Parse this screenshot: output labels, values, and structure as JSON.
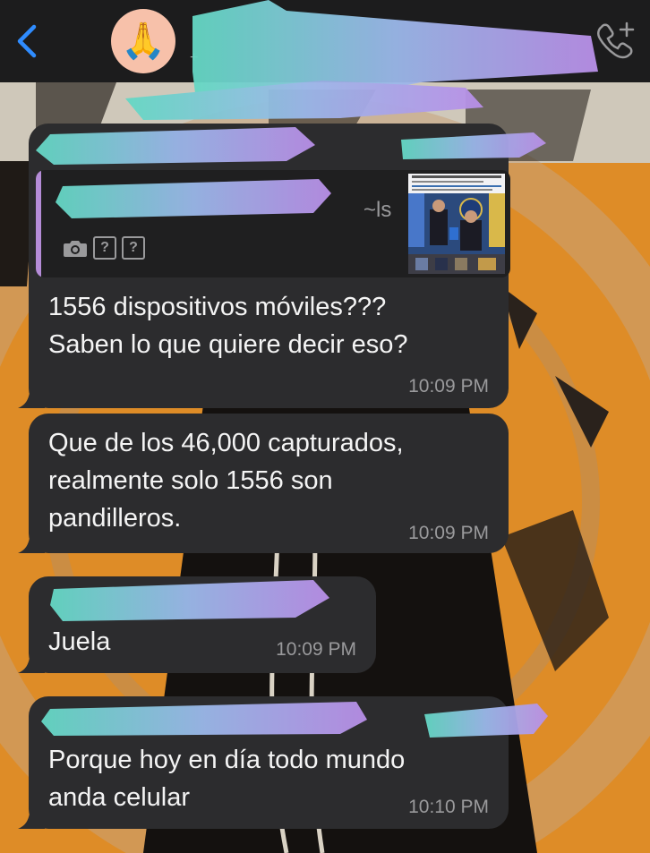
{
  "header": {
    "contact_name": "",
    "contact_sub": "+",
    "avatar_emoji": "🙏",
    "back_icon": "chevron-left-icon",
    "call_icon": "phone-plus-icon"
  },
  "messages": [
    {
      "sender": "",
      "quote": {
        "author": "",
        "author_suffix": "~ls",
        "icons": [
          "camera-icon",
          "?",
          "?"
        ]
      },
      "text": "1556 dispositivos móviles???\nSaben lo que quiere decir eso?",
      "time": "10:09 PM"
    },
    {
      "text": "Que de los 46,000 capturados,\nrealmente solo 1556 son\npandilleros.",
      "time": "10:09 PM"
    },
    {
      "sender": "",
      "text": "Juela",
      "time": "10:09 PM"
    },
    {
      "sender": "",
      "text": "Porque hoy en día todo mundo\nanda celular",
      "time": "10:10 PM"
    }
  ],
  "colors": {
    "accent_blue": "#2f8cff",
    "bubble": "#2c2c2e",
    "wallpaper_orange": "#e0902a",
    "redaction": "#8ad6d0"
  }
}
